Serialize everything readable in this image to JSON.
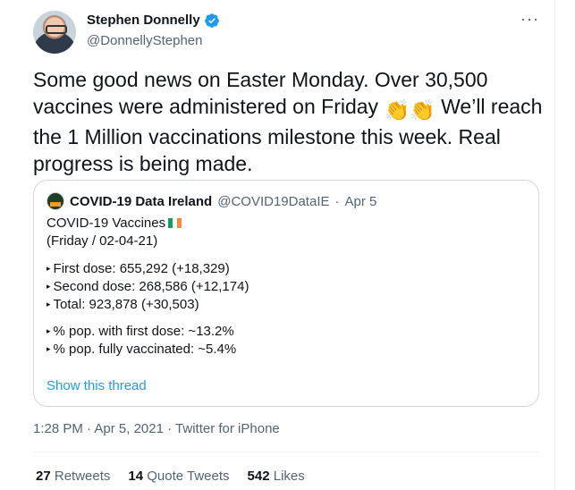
{
  "author": {
    "display_name": "Stephen Donnelly",
    "handle": "@DonnellyStephen",
    "verified": true
  },
  "more_icon": "more-horizontal-icon",
  "tweet": {
    "text_1": "Some good news on Easter Monday. Over 30,500 vaccines were administered on Friday ",
    "emoji": "👏👏",
    "text_2": " We’ll reach the 1 Million vaccinations milestone this week. Real progress is being made."
  },
  "quote": {
    "display_name": "COVID-19 Data Ireland",
    "handle": "@COVID19DataIE",
    "separator": "·",
    "date": "Apr 5",
    "title": "COVID-19 Vaccines",
    "date_line": "(Friday / 02-04-21)",
    "bullet": "▸",
    "lines_a": [
      "First dose: 655,292 (+18,329)",
      "Second dose: 268,586 (+12,174)",
      "Total: 923,878 (+30,503)"
    ],
    "lines_b": [
      "% pop. with first dose: ~13.2%",
      "% pop. fully vaccinated: ~5.4%"
    ],
    "show_thread": "Show this thread"
  },
  "meta": {
    "time": "1:28 PM",
    "separator": "·",
    "date": "Apr 5, 2021",
    "source": "Twitter for iPhone"
  },
  "stats": {
    "retweets_count": "27",
    "retweets_label": "Retweets",
    "quotes_count": "14",
    "quotes_label": "Quote Tweets",
    "likes_count": "542",
    "likes_label": "Likes"
  },
  "colors": {
    "accent": "#1d9bf0",
    "secondary_text": "#536471",
    "border": "#cfd9de"
  }
}
